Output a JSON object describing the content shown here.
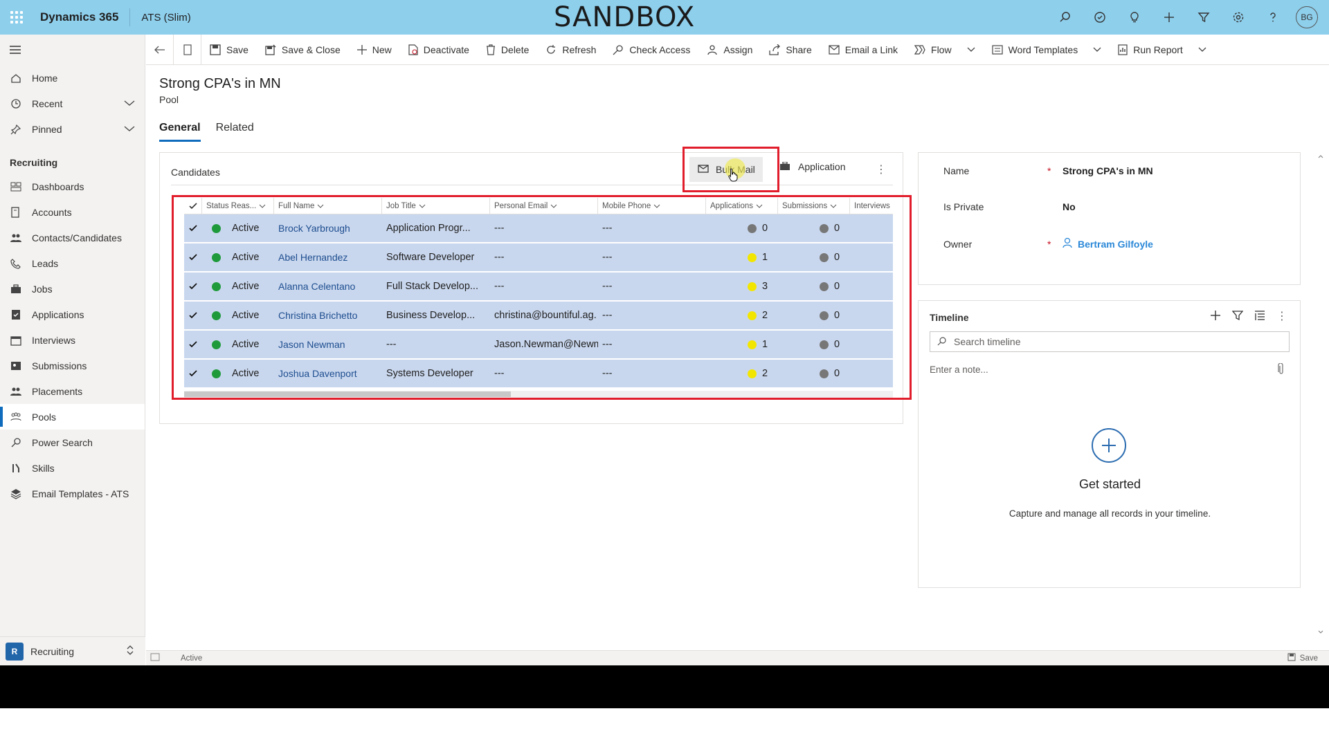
{
  "topbar": {
    "app_title": "Dynamics 365",
    "app_subtitle": "ATS (Slim)",
    "banner": "SANDBOX",
    "avatar_initials": "BG"
  },
  "leftnav": {
    "top_items": [
      {
        "label": "Home"
      },
      {
        "label": "Recent"
      },
      {
        "label": "Pinned"
      }
    ],
    "group_label": "Recruiting",
    "items": [
      {
        "label": "Dashboards"
      },
      {
        "label": "Accounts"
      },
      {
        "label": "Contacts/Candidates"
      },
      {
        "label": "Leads"
      },
      {
        "label": "Jobs"
      },
      {
        "label": "Applications"
      },
      {
        "label": "Interviews"
      },
      {
        "label": "Submissions"
      },
      {
        "label": "Placements"
      },
      {
        "label": "Pools"
      },
      {
        "label": "Power Search"
      },
      {
        "label": "Skills"
      },
      {
        "label": "Email Templates - ATS"
      }
    ],
    "area_badge": "R",
    "area_label": "Recruiting"
  },
  "commandbar": {
    "save": "Save",
    "save_close": "Save & Close",
    "new": "New",
    "deactivate": "Deactivate",
    "delete": "Delete",
    "refresh": "Refresh",
    "check_access": "Check Access",
    "assign": "Assign",
    "share": "Share",
    "email_link": "Email a Link",
    "flow": "Flow",
    "word_templates": "Word Templates",
    "run_report": "Run Report"
  },
  "record": {
    "title": "Strong CPA's in MN",
    "type": "Pool",
    "tabs": [
      "General",
      "Related"
    ]
  },
  "candidates": {
    "title": "Candidates",
    "bulk_mail": "Bulk Mail",
    "application": "Application",
    "columns": [
      "Status Reas...",
      "Full Name",
      "Job Title",
      "Personal Email",
      "Mobile Phone",
      "Applications",
      "Submissions",
      "Interviews"
    ],
    "rows": [
      {
        "status": "Active",
        "name": "Brock Yarbrough",
        "job": "Application Progr...",
        "email": "---",
        "phone": "---",
        "apps": "0",
        "apps_color": "gray",
        "subs": "0"
      },
      {
        "status": "Active",
        "name": "Abel Hernandez",
        "job": "Software Developer",
        "email": "---",
        "phone": "---",
        "apps": "1",
        "apps_color": "yellow",
        "subs": "0"
      },
      {
        "status": "Active",
        "name": "Alanna Celentano",
        "job": "Full Stack Develop...",
        "email": "---",
        "phone": "---",
        "apps": "3",
        "apps_color": "yellow",
        "subs": "0"
      },
      {
        "status": "Active",
        "name": "Christina Brichetto",
        "job": "Business Develop...",
        "email": "christina@bountiful.ag.",
        "phone": "---",
        "apps": "2",
        "apps_color": "yellow",
        "subs": "0"
      },
      {
        "status": "Active",
        "name": "Jason Newman",
        "job": "---",
        "email": "Jason.Newman@Newm",
        "phone": "---",
        "apps": "1",
        "apps_color": "yellow",
        "subs": "0"
      },
      {
        "status": "Active",
        "name": "Joshua Davenport",
        "job": "Systems Developer",
        "email": "---",
        "phone": "---",
        "apps": "2",
        "apps_color": "yellow",
        "subs": "0"
      }
    ]
  },
  "details": {
    "name_label": "Name",
    "name_value": "Strong CPA's in MN",
    "private_label": "Is Private",
    "private_value": "No",
    "owner_label": "Owner",
    "owner_value": "Bertram Gilfoyle",
    "required_mark": "*"
  },
  "timeline": {
    "title": "Timeline",
    "search_placeholder": "Search timeline",
    "note_placeholder": "Enter a note...",
    "get_started": "Get started",
    "caption": "Capture and manage all records in your timeline."
  },
  "statusbar": {
    "status": "Active",
    "save": "Save"
  },
  "colors": {
    "topbar": "#8ecfec",
    "row_selected": "#c9d7ee",
    "annotation_red": "#e11d2b",
    "status_green": "#1f9a3b",
    "count_yellow": "#f2e600"
  }
}
